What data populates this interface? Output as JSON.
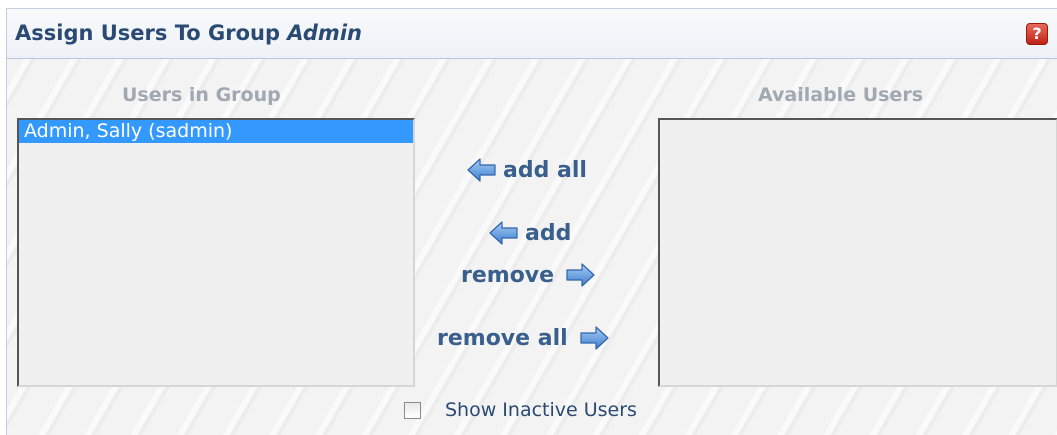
{
  "panel": {
    "title_prefix": "Assign Users To Group ",
    "group_name": "Admin",
    "help_glyph": "?"
  },
  "left": {
    "label": "Users in Group",
    "items": [
      {
        "text": "Admin, Sally (sadmin)",
        "selected": true
      }
    ]
  },
  "right": {
    "label": "Available Users",
    "items": []
  },
  "buttons": {
    "add_all": "add all",
    "add": "add",
    "remove": "remove",
    "remove_all": "remove all"
  },
  "options": {
    "show_inactive_label": "Show Inactive Users",
    "show_inactive_checked": false
  },
  "colors": {
    "accent": "#2b4a73",
    "selection": "#3399ff",
    "arrow": "#4f8fde"
  }
}
